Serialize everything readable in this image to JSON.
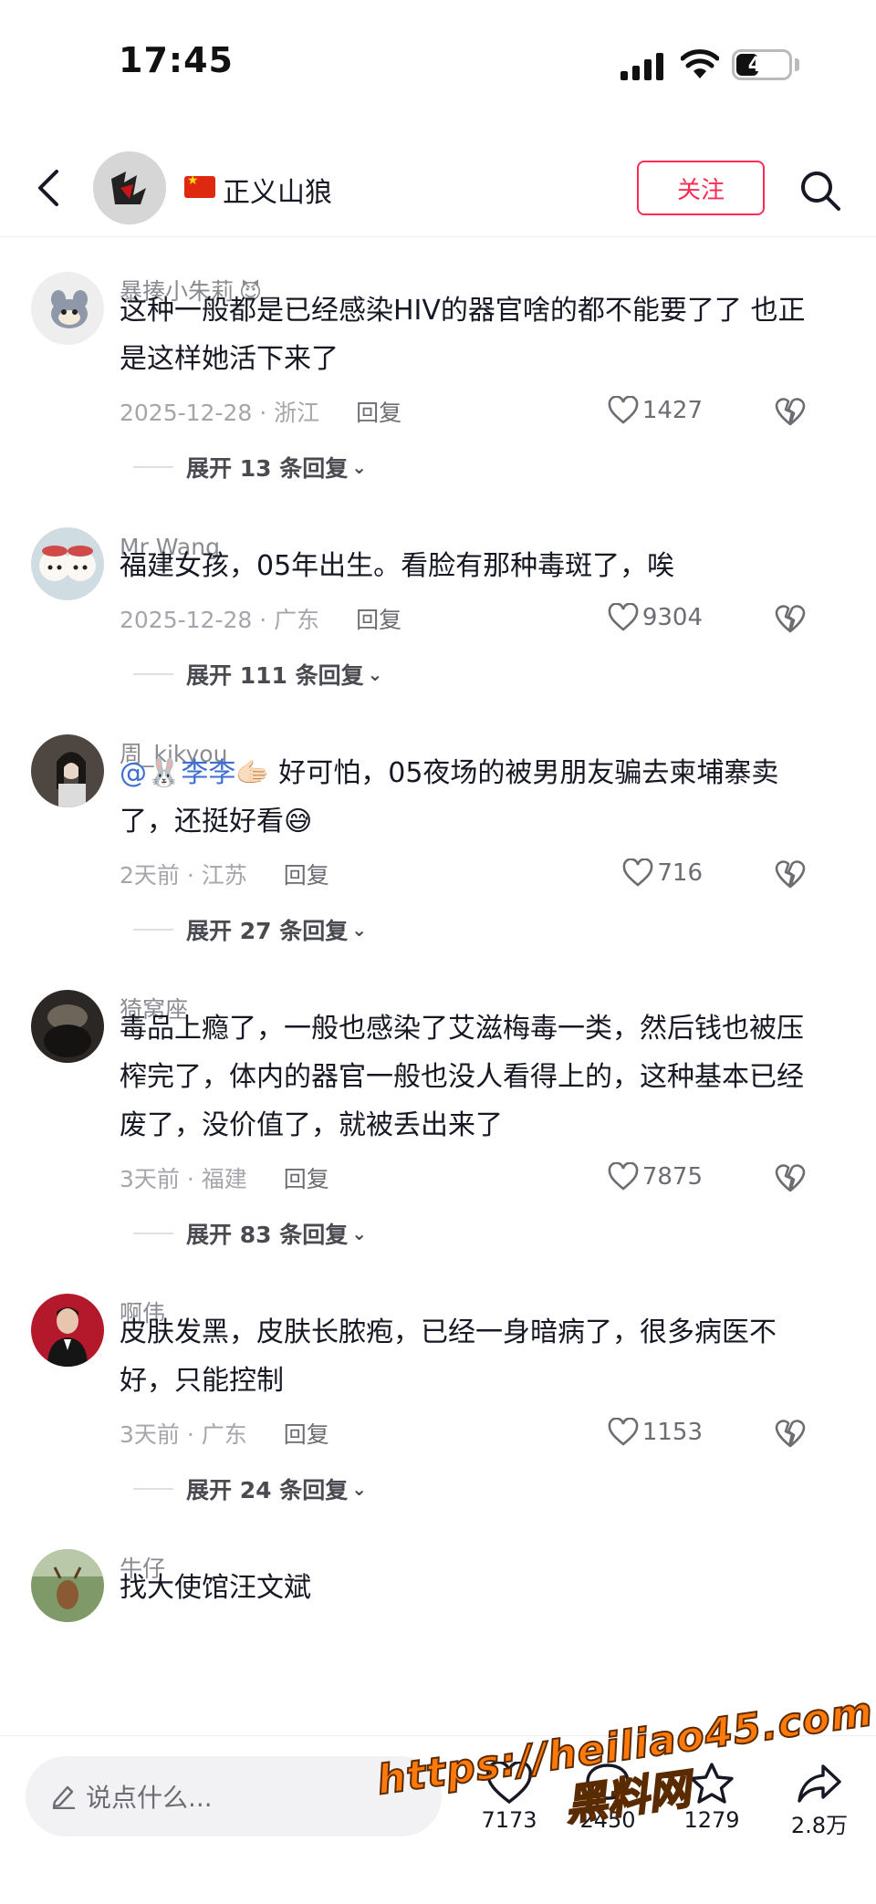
{
  "status_bar": {
    "time": "17:45",
    "battery": "42",
    "battery_level": 0.42
  },
  "header": {
    "profile_name": "正义山狼",
    "follow_label": "关注"
  },
  "comments": [
    {
      "user": "暴揍小朱莉",
      "badge": "😈",
      "text": "这种一般都是已经感染HIV的器官啥的都不能要了了 也正是这样她活下来了",
      "time": "2025-12-28 · 浙江",
      "reply": "回复",
      "likes": "1427",
      "expand": "展开 13 条回复",
      "avatar_color": "#e9e9e9"
    },
    {
      "user": "Mr Wang",
      "text": "福建女孩，05年出生。看脸有那种毒斑了，唉",
      "time": "2025-12-28 · 广东",
      "reply": "回复",
      "likes": "9304",
      "expand": "展开 111 条回复",
      "avatar_color": "#c9d7dc"
    },
    {
      "user": "周_kikyou",
      "mention": "@🐰李李🫱🏻",
      "text": " 好可怕，05夜场的被男朋友骗去柬埔寨卖了，还挺好看😅",
      "time": "2天前 · 江苏",
      "reply": "回复",
      "likes": "716",
      "expand": "展开 27 条回复",
      "avatar_color": "#6a5a52"
    },
    {
      "user": "猗窝座",
      "text": "毒品上瘾了，一般也感染了艾滋梅毒一类，然后钱也被压榨完了，体内的器官一般也没人看得上的，这种基本已经废了，没价值了，就被丢出来了",
      "time": "3天前 · 福建",
      "reply": "回复",
      "likes": "7875",
      "expand": "展开 83 条回复",
      "avatar_color": "#3d3a36"
    },
    {
      "user": "啊伟",
      "text": "皮肤发黑，皮肤长脓疱，已经一身暗病了，很多病医不好，只能控制",
      "time": "3天前 · 广东",
      "reply": "回复",
      "likes": "1153",
      "expand": "展开 24 条回复",
      "avatar_color": "#b3182b"
    },
    {
      "user": "牛仔",
      "text": "找大使馆汪文斌",
      "avatar_color": "#6d8a58"
    }
  ],
  "bottom_bar": {
    "placeholder": "说点什么...",
    "like_count": "7173",
    "comment_count": "2450",
    "favorite_count": "1279",
    "share_count": "2.8万"
  },
  "watermark": {
    "url": "https://heiliao45.com",
    "label": "黑料网"
  },
  "colors": {
    "accent": "#fe2c55",
    "mention": "#3e6ed2",
    "watermark": "#ff7a0a"
  }
}
